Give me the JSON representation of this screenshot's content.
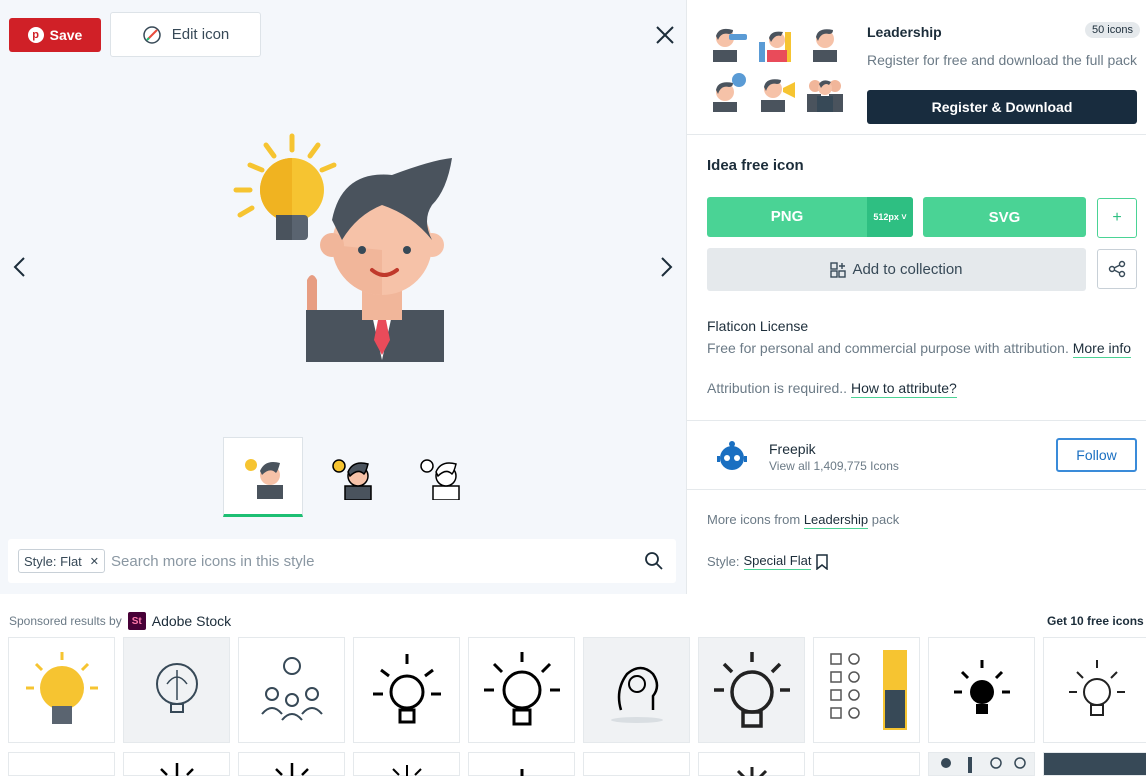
{
  "viewer": {
    "save_label": "Save",
    "edit_label": "Edit icon",
    "search": {
      "style_tag": "Style: Flat",
      "placeholder": "Search more icons in this style"
    }
  },
  "pack": {
    "title": "Leadership",
    "count": "50 icons",
    "description": "Register for free and download the full pack",
    "button": "Register & Download"
  },
  "icon": {
    "title": "Idea free icon",
    "png_label": "PNG",
    "png_size": "512px ˅",
    "svg_label": "SVG",
    "plus_label": "+",
    "collection_label": "Add to collection"
  },
  "license": {
    "title": "Flaticon License",
    "description": "Free for personal and commercial purpose with attribution.",
    "more_info": "More info",
    "attribution_text": "Attribution is required..",
    "attribution_link": "How to attribute?"
  },
  "author": {
    "name": "Freepik",
    "sub": "View all 1,409,775 Icons",
    "follow": "Follow"
  },
  "more": {
    "prefix": "More icons from",
    "link": "Leadership",
    "suffix": "pack"
  },
  "style_line": {
    "prefix": "Style:",
    "link": "Special Flat"
  },
  "sponsored": {
    "label": "Sponsored results by",
    "logo": "St",
    "brand": "Adobe Stock",
    "get10": "Get 10 free icons"
  },
  "colors": {
    "accent_green": "#4ad395",
    "save_red": "#d02027",
    "dark_navy": "#182c3e",
    "follow_blue": "#3a8bd9"
  }
}
